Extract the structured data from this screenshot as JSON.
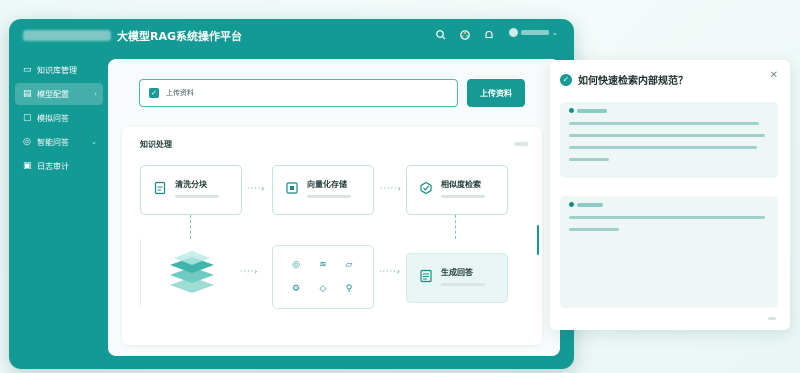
{
  "app": {
    "title": "大模型RAG系统操作平台"
  },
  "topbar": {
    "icons": [
      "search-icon",
      "palette-icon",
      "bell-icon",
      "user-icon"
    ]
  },
  "sidebar": {
    "items": [
      {
        "label": "知识库管理",
        "icon": "book-icon"
      },
      {
        "label": "模型配置",
        "icon": "document-icon",
        "active": true,
        "has_arrow": true
      },
      {
        "label": "模拟问答",
        "icon": "chat-icon"
      },
      {
        "label": "智能问答",
        "icon": "help-icon",
        "has_arrow": true
      },
      {
        "label": "日志审计",
        "icon": "log-icon"
      }
    ]
  },
  "upload": {
    "field_label": "上传资料",
    "button_label": "上传资料"
  },
  "process": {
    "title": "知识处理",
    "nodes": [
      {
        "label": "清洗分块",
        "icon": "file-icon"
      },
      {
        "label": "向量化存储",
        "icon": "database-icon"
      },
      {
        "label": "相似度检索",
        "icon": "cube-icon"
      },
      {
        "label": "生成回答",
        "icon": "answer-icon"
      }
    ]
  },
  "panel": {
    "title": "如何快速检索内部规范？"
  },
  "colors": {
    "primary": "#159a94",
    "accent_light": "#e8f5f4"
  }
}
